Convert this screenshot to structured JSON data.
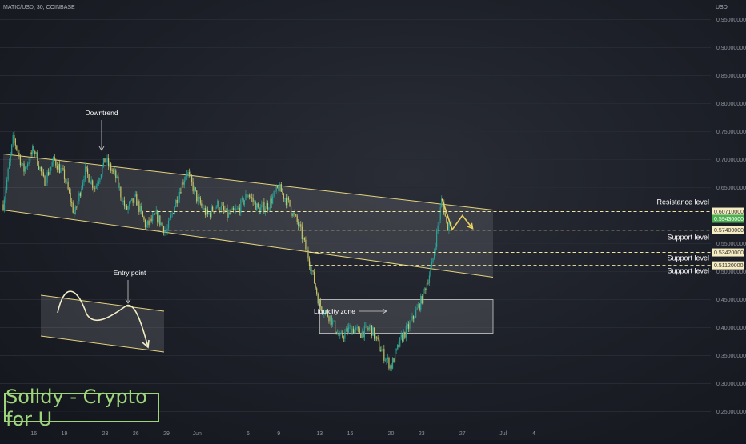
{
  "header": {
    "symbol": "MATIC/USD, 30, COINBASE",
    "currency": "USD"
  },
  "brand": {
    "text": "Solldy - Crypto for U"
  },
  "colors": {
    "up": "#26a69a",
    "down": "#c8c86a",
    "channel_line": "#e3d27e",
    "channel_fill": "rgba(255,255,255,0.10)",
    "dash_line": "#f0e6a0",
    "projection": "#e8cf5e",
    "label_bg": "#f5ecc2",
    "current_label_bg": "#4caf50"
  },
  "chart_data": {
    "type": "candlestick",
    "title": "MATIC/USD, 30, COINBASE",
    "ylabel": "USD",
    "ylim": [
      0.225,
      0.985
    ],
    "grid": true,
    "y_ticks": [
      "0.95000000",
      "0.90000000",
      "0.85000000",
      "0.80000000",
      "0.75000000",
      "0.70000000",
      "0.65000000",
      "0.55000000",
      "0.50000000",
      "0.45000000",
      "0.40000000",
      "0.35000000",
      "0.30000000",
      "0.25000000"
    ],
    "y_tick_values": [
      0.95,
      0.9,
      0.85,
      0.8,
      0.75,
      0.7,
      0.65,
      0.55,
      0.5,
      0.45,
      0.4,
      0.35,
      0.3,
      0.25
    ],
    "x_ticks": [
      "16",
      "19",
      "23",
      "26",
      "29",
      "Jun",
      "6",
      "9",
      "13",
      "16",
      "20",
      "23",
      "27",
      "Jul",
      "4"
    ],
    "price_path": [
      [
        "May 13",
        0.62
      ],
      [
        "May 14",
        0.74
      ],
      [
        "May 15",
        0.68
      ],
      [
        "May 16",
        0.72
      ],
      [
        "May 17",
        0.66
      ],
      [
        "May 18",
        0.7
      ],
      [
        "May 19",
        0.67
      ],
      [
        "May 20",
        0.6
      ],
      [
        "May 21",
        0.68
      ],
      [
        "May 22",
        0.65
      ],
      [
        "May 23",
        0.7
      ],
      [
        "May 24",
        0.67
      ],
      [
        "May 25",
        0.61
      ],
      [
        "May 26",
        0.63
      ],
      [
        "May 27",
        0.58
      ],
      [
        "May 28",
        0.6
      ],
      [
        "May 29",
        0.57
      ],
      [
        "May 30",
        0.63
      ],
      [
        "May 31",
        0.68
      ],
      [
        "Jun 1",
        0.63
      ],
      [
        "Jun 2",
        0.6
      ],
      [
        "Jun 3",
        0.62
      ],
      [
        "Jun 4",
        0.6
      ],
      [
        "Jun 5",
        0.61
      ],
      [
        "Jun 6",
        0.64
      ],
      [
        "Jun 7",
        0.61
      ],
      [
        "Jun 8",
        0.62
      ],
      [
        "Jun 9",
        0.65
      ],
      [
        "Jun 10",
        0.62
      ],
      [
        "Jun 11",
        0.58
      ],
      [
        "Jun 12",
        0.52
      ],
      [
        "Jun 13",
        0.44
      ],
      [
        "Jun 14",
        0.42
      ],
      [
        "Jun 15",
        0.38
      ],
      [
        "Jun 16",
        0.4
      ],
      [
        "Jun 17",
        0.39
      ],
      [
        "Jun 18",
        0.4
      ],
      [
        "Jun 19",
        0.36
      ],
      [
        "Jun 20",
        0.33
      ],
      [
        "Jun 21",
        0.38
      ],
      [
        "Jun 22",
        0.41
      ],
      [
        "Jun 23",
        0.45
      ],
      [
        "Jun 24",
        0.51
      ],
      [
        "Jun 25",
        0.63
      ],
      [
        "Jun 25b",
        0.58
      ],
      [
        "Jun 26",
        0.595
      ]
    ],
    "channel": {
      "upper": [
        [
          "May 13",
          0.71
        ],
        [
          "Jun 30",
          0.61
        ]
      ],
      "lower": [
        [
          "May 13",
          0.61
        ],
        [
          "Jun 30",
          0.49
        ]
      ]
    },
    "liquidity_zone": {
      "x": [
        "Jun 13",
        "Jun 30"
      ],
      "y": [
        0.39,
        0.45
      ]
    },
    "levels": [
      {
        "price": 0.6071,
        "label": "0.60710000",
        "name": "Resistance level"
      },
      {
        "price": 0.5943,
        "label": "0.59430000",
        "name": "",
        "current": true
      },
      {
        "price": 0.574,
        "label": "0.57400000",
        "name": "Support level"
      },
      {
        "price": 0.5342,
        "label": "0.53420000",
        "name": "Support level"
      },
      {
        "price": 0.5112,
        "label": "0.51120000",
        "name": "Support level"
      }
    ],
    "projection": [
      [
        "Jun 25",
        0.63
      ],
      [
        "Jun 26",
        0.575
      ],
      [
        "Jun 27",
        0.6
      ],
      [
        "Jun 28",
        0.577
      ]
    ],
    "annotations": [
      {
        "text": "Downtrend",
        "x": "May 21",
        "y": 0.74
      },
      {
        "text": "Entry point",
        "x": "inset",
        "y": 0
      },
      {
        "text": "Liquidity zone",
        "x": "Jun 12",
        "y": 0.425
      }
    ],
    "inset_example": "Entry point"
  }
}
